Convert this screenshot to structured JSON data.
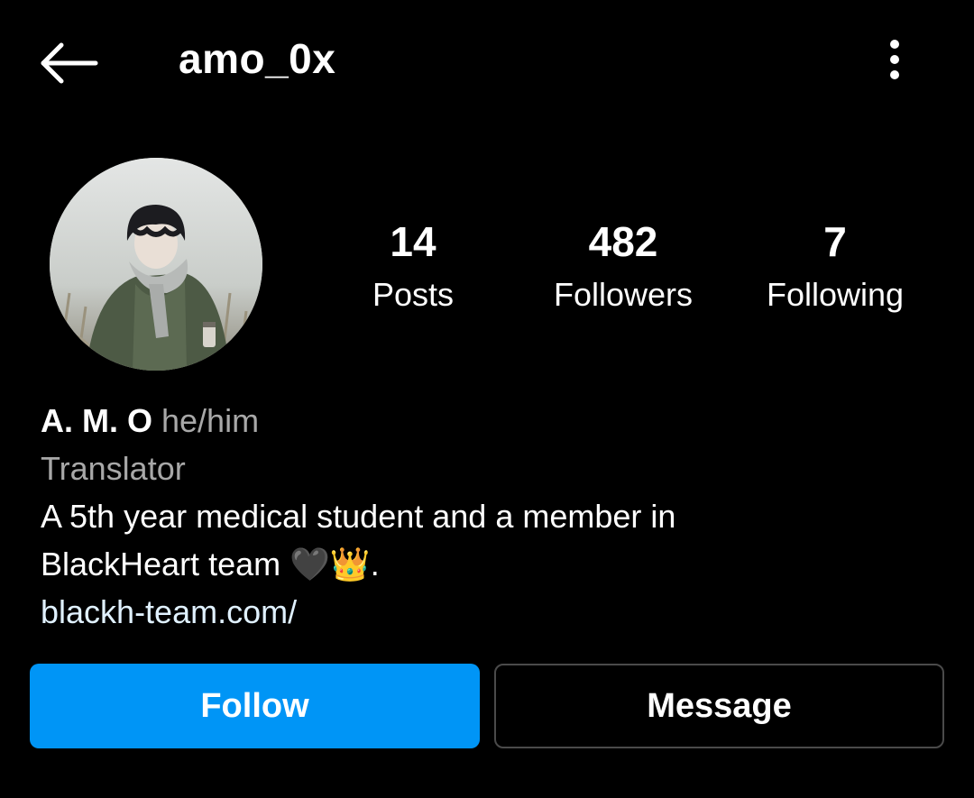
{
  "header": {
    "username": "amo_0x",
    "back_icon": "arrow-left-icon",
    "menu_icon": "more-vertical-icon"
  },
  "profile": {
    "avatar_icon": "avatar-photo",
    "stats": {
      "posts_count": "14",
      "posts_label": "Posts",
      "followers_count": "482",
      "followers_label": "Followers",
      "following_count": "7",
      "following_label": "Following"
    },
    "name": "A. M. O",
    "pronouns": "he/him",
    "category": "Translator",
    "bio_line1": "A 5th year medical student and a member in",
    "bio_line2": "BlackHeart team 🖤👑.",
    "link": "blackh-team.com/"
  },
  "actions": {
    "follow_label": "Follow",
    "message_label": "Message"
  },
  "colors": {
    "background": "#000000",
    "accent": "#0095f6",
    "secondary_text": "#a8a8a8",
    "link_text": "#e0f1ff",
    "button_border": "#4a4a4a"
  }
}
